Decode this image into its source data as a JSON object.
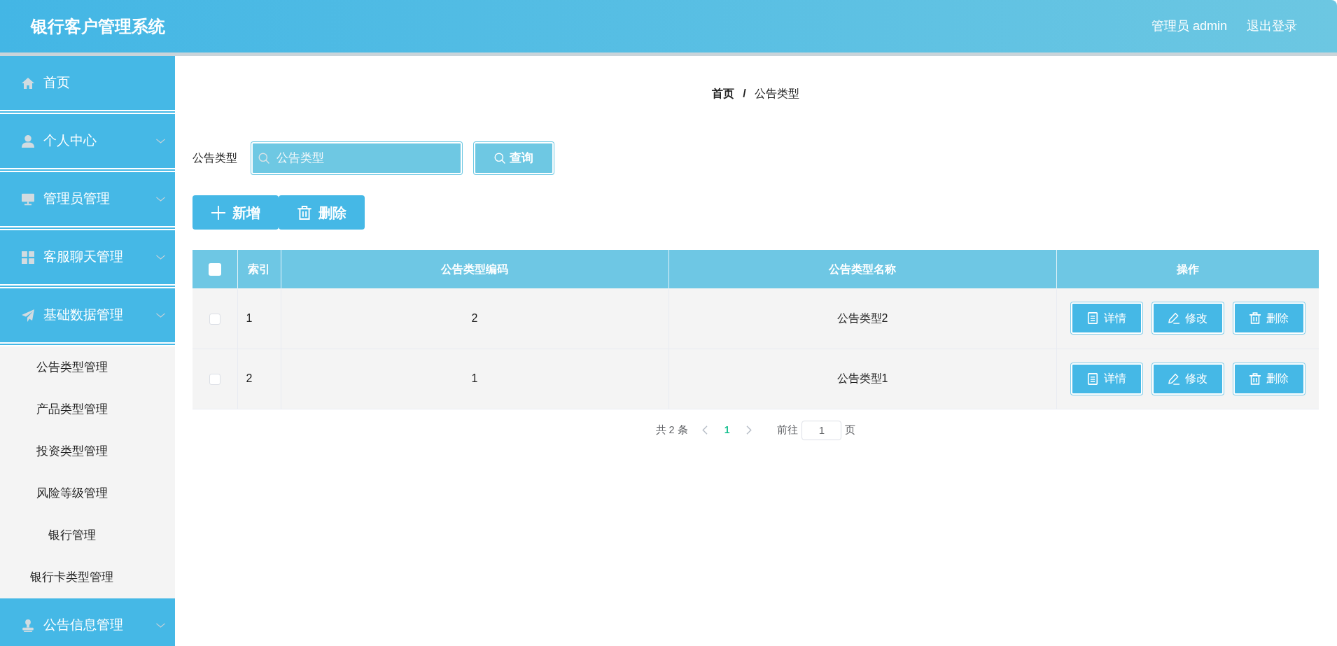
{
  "header": {
    "title": "银行客户管理系统",
    "user": "管理员 admin",
    "logout": "退出登录"
  },
  "sidebar": {
    "items": [
      {
        "label": "首页",
        "kind": "link"
      },
      {
        "label": "个人中心",
        "kind": "menu"
      },
      {
        "label": "管理员管理",
        "kind": "menu"
      },
      {
        "label": "客服聊天管理",
        "kind": "menu"
      },
      {
        "label": "基础数据管理",
        "kind": "menu",
        "children": [
          {
            "label": "公告类型管理"
          },
          {
            "label": "产品类型管理"
          },
          {
            "label": "投资类型管理"
          },
          {
            "label": "风险等级管理"
          },
          {
            "label": "银行管理"
          },
          {
            "label": "银行卡类型管理"
          }
        ]
      },
      {
        "label": "公告信息管理",
        "kind": "menu"
      }
    ]
  },
  "breadcrumb": {
    "items": [
      "首页",
      "公告类型"
    ],
    "separator": "/"
  },
  "search": {
    "label": "公告类型",
    "placeholder": "公告类型",
    "button": "查询"
  },
  "toolbar": {
    "buttons": [
      {
        "kind": "add",
        "label": "新增"
      },
      {
        "kind": "delete",
        "label": "删除"
      }
    ]
  },
  "table": {
    "select_all": {
      "checked": false
    },
    "columns": [
      "索引",
      "公告类型编码",
      "公告类型名称",
      "操作"
    ],
    "rows": [
      {
        "checked": false,
        "index": "1",
        "code": "2",
        "name": "公告类型2",
        "actions": [
          {
            "kind": "detail",
            "label": "详情"
          },
          {
            "kind": "edit",
            "label": "修改"
          },
          {
            "kind": "delete",
            "label": "删除"
          }
        ]
      },
      {
        "checked": false,
        "index": "2",
        "code": "1",
        "name": "公告类型1",
        "actions": [
          {
            "kind": "detail",
            "label": "详情"
          },
          {
            "kind": "edit",
            "label": "修改"
          },
          {
            "kind": "delete",
            "label": "删除"
          }
        ]
      }
    ]
  },
  "pagination": {
    "total": "共 2 条",
    "pages": [
      {
        "label": "1",
        "selected": true
      }
    ],
    "goto_label": "前往",
    "goto_value": "1",
    "goto_suffix": "页"
  }
}
